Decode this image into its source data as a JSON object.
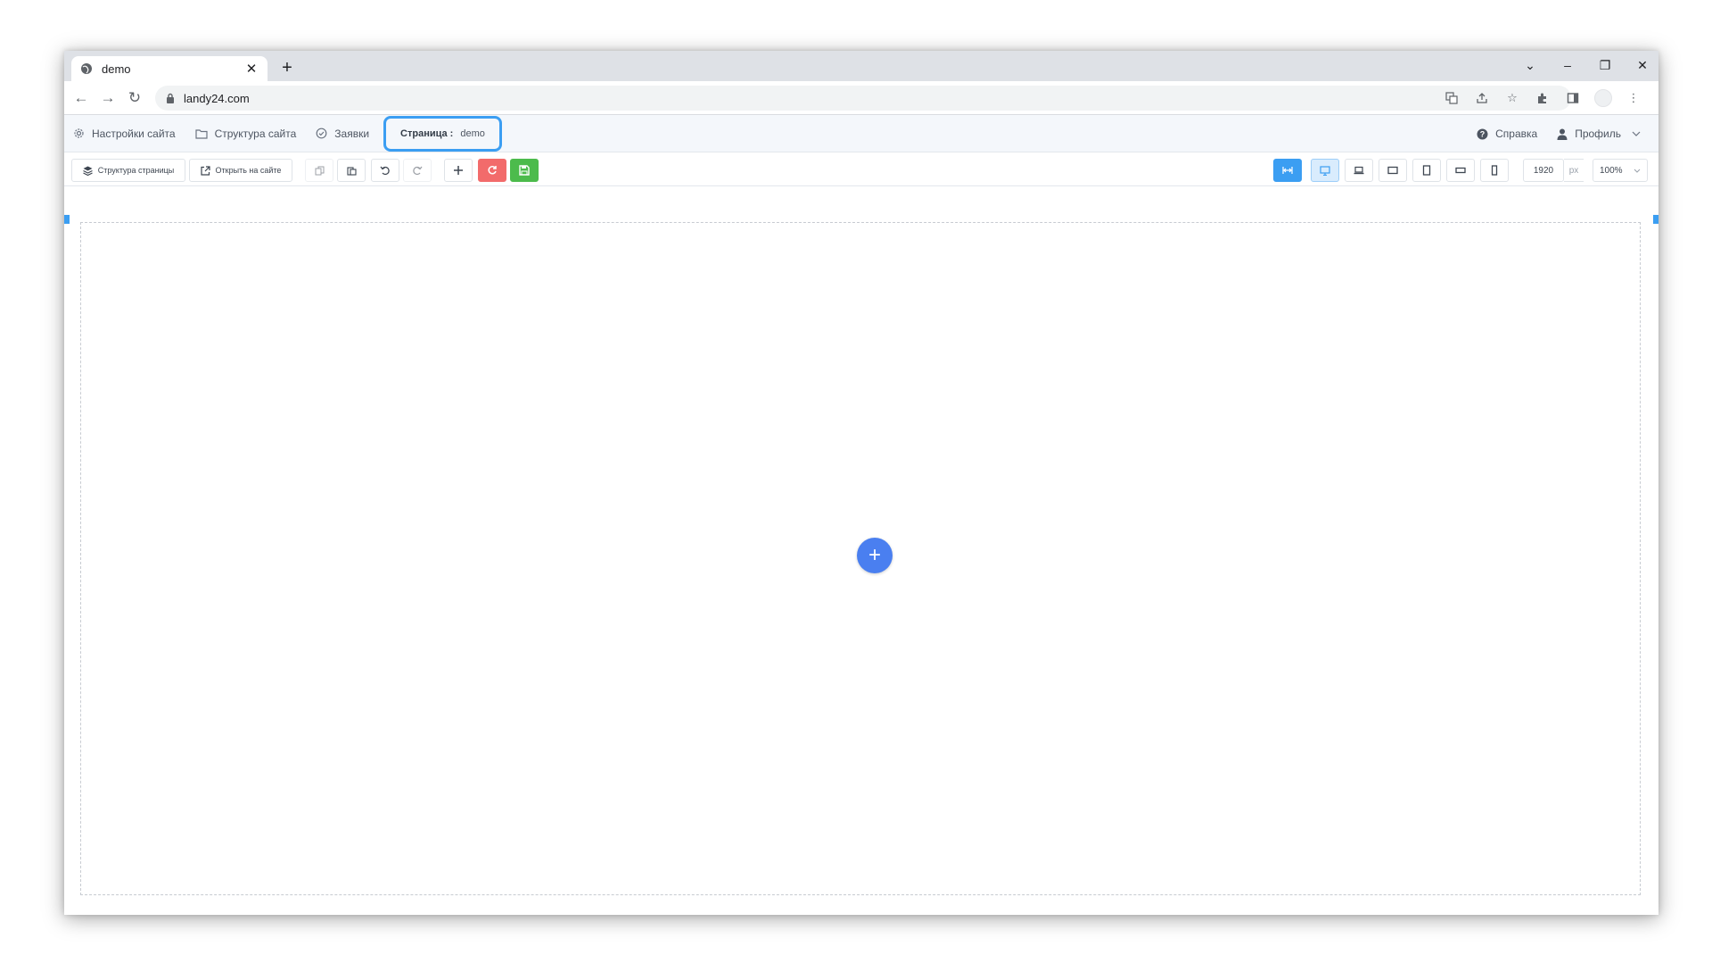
{
  "browser": {
    "tab_title": "demo",
    "url": "landy24.com",
    "new_tab_label": "+",
    "close_tab_label": "✕"
  },
  "app_menu": {
    "items": [
      {
        "label": "Настройки сайта"
      },
      {
        "label": "Структура сайта"
      },
      {
        "label": "Заявки"
      }
    ],
    "page_label": "Страница :",
    "page_name": "demo",
    "help_label": "Справка",
    "profile_label": "Профиль"
  },
  "toolbar": {
    "page_structure_label": "Структура страницы",
    "open_on_site_label": "Открыть на сайте",
    "width_value": "1920",
    "width_unit": "px",
    "zoom_value": "100%"
  },
  "canvas": {
    "add_block_label": "+"
  },
  "colors": {
    "accent_blue": "#3b9ef2",
    "add_button": "#4a7ff0",
    "reset_red": "#f26b6b",
    "save_green": "#4cbb4c"
  }
}
